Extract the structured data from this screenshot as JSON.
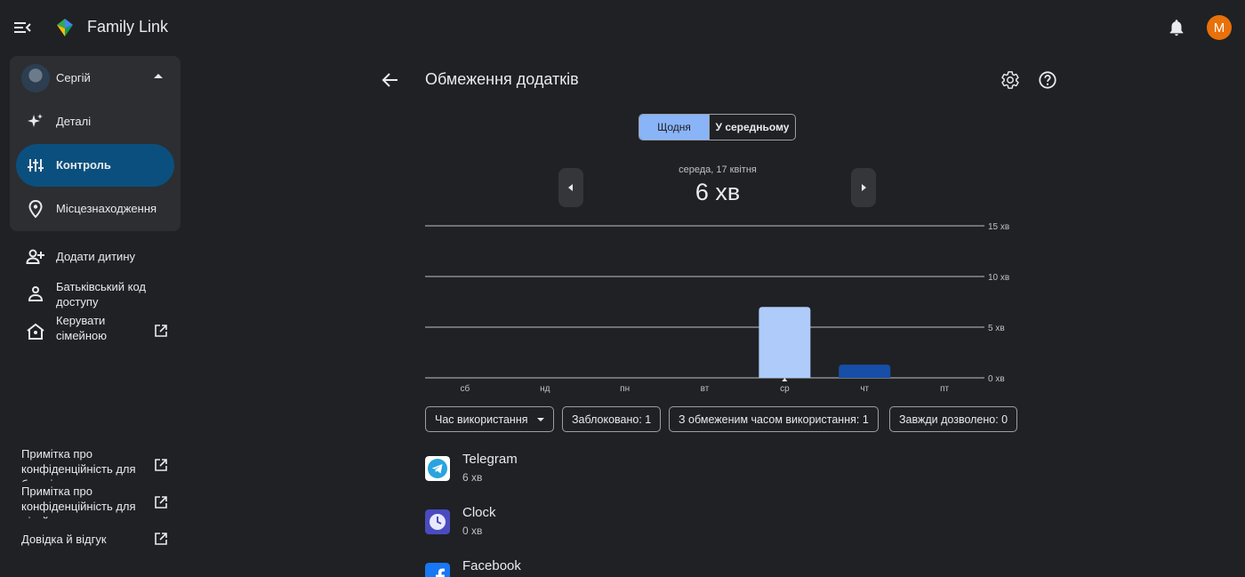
{
  "header": {
    "app_title": "Family Link",
    "account_initial": "M"
  },
  "sidebar": {
    "child_name": "Сергій",
    "items": [
      {
        "label": "Деталі",
        "icon": "sparkle-icon"
      },
      {
        "label": "Контроль",
        "icon": "tune-icon",
        "active": true
      },
      {
        "label": "Місцезнаходження",
        "icon": "location-pin-icon"
      }
    ],
    "links": [
      {
        "label": "Додати дитину",
        "icon": "add-person-icon"
      },
      {
        "label": "Батьківський код доступу",
        "icon": "parent-code-icon"
      },
      {
        "label": "Керувати сімейною групою",
        "icon": "family-home-icon",
        "external": true
      }
    ],
    "footer": [
      {
        "label": "Примітка про конфіденційність для батьків"
      },
      {
        "label": "Примітка про конфіденційність для дітей"
      },
      {
        "label": "Довідка й відгук"
      }
    ]
  },
  "main": {
    "title": "Обмеження додатків",
    "toggle": {
      "daily": "Щодня",
      "average": "У середньому"
    },
    "date": "середа, 17 квітня",
    "total": "6 хв",
    "filters": {
      "usage_time": "Час використання",
      "blocked": "Заблоковано: 1",
      "limited": "З обмеженим часом використання: 1",
      "always_allowed": "Завжди дозволено: 0"
    },
    "apps": [
      {
        "name": "Telegram",
        "time": "6 хв",
        "icon": "telegram-icon"
      },
      {
        "name": "Clock",
        "time": "0 хв",
        "icon": "clock-icon"
      },
      {
        "name": "Facebook",
        "time": "",
        "icon": "facebook-icon"
      }
    ]
  },
  "chart_data": {
    "type": "bar",
    "categories": [
      "сб",
      "нд",
      "пн",
      "вт",
      "ср",
      "чт",
      "пт"
    ],
    "values": [
      0,
      0,
      0,
      0,
      7,
      1.3,
      0
    ],
    "selected_index": 4,
    "y_ticks": [
      "0 хв",
      "5 хв",
      "10 хв",
      "15 хв"
    ],
    "y_tick_values": [
      0,
      5,
      10,
      15
    ],
    "ylim": [
      0,
      15
    ],
    "colors": {
      "selected": "#aecbfa",
      "other": "#174ea6",
      "grid": "#bdc1c6"
    }
  }
}
